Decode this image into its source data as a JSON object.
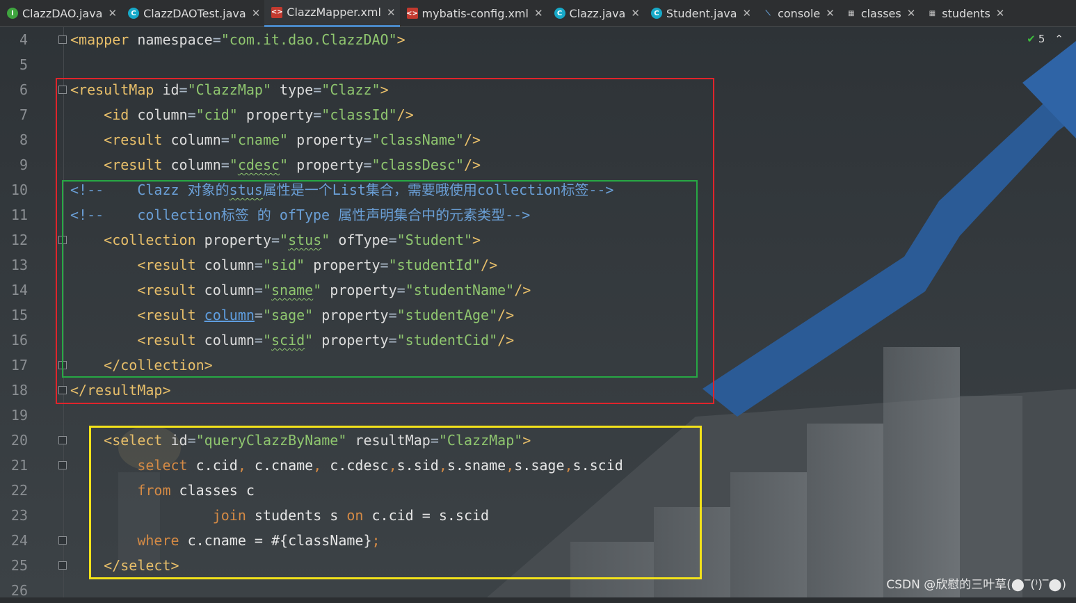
{
  "tabs": [
    {
      "label": "ClazzDAO.java",
      "icon": "interface-icon"
    },
    {
      "label": "ClazzDAOTest.java",
      "icon": "class-icon"
    },
    {
      "label": "ClazzMapper.xml",
      "icon": "xml-icon",
      "active": true
    },
    {
      "label": "mybatis-config.xml",
      "icon": "xml-icon"
    },
    {
      "label": "Clazz.java",
      "icon": "class-icon"
    },
    {
      "label": "Student.java",
      "icon": "class-icon"
    },
    {
      "label": "console",
      "icon": "console-icon"
    },
    {
      "label": "classes",
      "icon": "table-icon"
    },
    {
      "label": "students",
      "icon": "table-icon"
    }
  ],
  "close_glyph": "✕",
  "inspection": {
    "count": "5",
    "up_glyph": "⌃"
  },
  "line_numbers": [
    "4",
    "5",
    "6",
    "7",
    "8",
    "9",
    "10",
    "11",
    "12",
    "13",
    "14",
    "15",
    "16",
    "17",
    "18",
    "19",
    "20",
    "21",
    "22",
    "23",
    "24",
    "25",
    "26"
  ],
  "code": {
    "l4": {
      "t1": "<mapper ",
      "a1": "namespace",
      "v1": "\"com.it.dao.ClazzDAO\"",
      "t2": ">"
    },
    "l6": {
      "t1": "<resultMap ",
      "a1": "id",
      "v1": "\"ClazzMap\"",
      "a2": " type",
      "v2": "\"Clazz\"",
      "t2": ">"
    },
    "l7": {
      "t1": "<id ",
      "a1": "column",
      "v1": "\"cid\"",
      "a2": " property",
      "v2": "\"classId\"",
      "t2": "/>"
    },
    "l8": {
      "t1": "<result ",
      "a1": "column",
      "v1": "\"cname\"",
      "a2": " property",
      "v2": "\"className\"",
      "t2": "/>"
    },
    "l9": {
      "t1": "<result ",
      "a1": "column",
      "v1q1": "\"",
      "v1": "cdesc",
      "v1q2": "\"",
      "a2": " property",
      "v2": "\"classDesc\"",
      "t2": "/>"
    },
    "l10": {
      "c1": "<!--    Clazz 对象的",
      "c2": "stus",
      "c3": "属性是一个List集合，需要哦使用collection标签-->"
    },
    "l11": {
      "c1": "<!--    collection标签 的 ofType 属性声明集合中的元素类型-->"
    },
    "l12": {
      "t1": "<collection ",
      "a1": "property",
      "v1q1": "\"",
      "v1": "stus",
      "v1q2": "\"",
      "a2": " ofType",
      "v2": "\"Student\"",
      "t2": ">"
    },
    "l13": {
      "t1": "<result ",
      "a1": "column",
      "v1": "\"sid\"",
      "a2": " property",
      "v2": "\"studentId\"",
      "t2": "/>"
    },
    "l14": {
      "t1": "<result ",
      "a1": "column",
      "v1q1": "\"",
      "v1": "sname",
      "v1q2": "\"",
      "a2": " property",
      "v2": "\"studentName\"",
      "t2": "/>"
    },
    "l15": {
      "t1": "<result ",
      "a1": "column",
      "v1": "\"sage\"",
      "a2": " property",
      "v2": "\"studentAge\"",
      "t2": "/>"
    },
    "l16": {
      "t1": "<result ",
      "a1": "column",
      "v1q1": "\"",
      "v1": "scid",
      "v1q2": "\"",
      "a2": " property",
      "v2": "\"studentCid\"",
      "t2": "/>"
    },
    "l17": {
      "t1": "</collection>"
    },
    "l18": {
      "t1": "</resultMap>"
    },
    "l20": {
      "t1": "<select ",
      "a1": "id",
      "v1": "\"queryClazzByName\"",
      "a2": " resultMap",
      "v2": "\"ClazzMap\"",
      "t2": ">"
    },
    "l21": {
      "k1": "select",
      "r1": " c.cid",
      "p1": ",",
      "r2": " c.cname",
      "p2": ",",
      "r3": " c.cdesc",
      "p3": ",",
      "r4": "s.sid",
      "p4": ",",
      "r5": "s.sname",
      "p5": ",",
      "r6": "s.sage",
      "p6": ",",
      "r7": "s.scid"
    },
    "l22": {
      "k1": "from",
      "r1": " classes c"
    },
    "l23": {
      "k1": "join",
      "r1": " students s ",
      "k2": "on",
      "r2": " c.cid = s.scid"
    },
    "l24": {
      "k1": "where",
      "r1": " c.cname = #{className}",
      "p1": ";"
    },
    "l25": {
      "t1": "</select>"
    }
  },
  "eq": "=",
  "watermark": "CSDN @欣慰的三叶草(⬤‾(⁾)‾⬤)",
  "colors": {
    "red_box": "#e0242b",
    "green_box": "#27a844",
    "yellow_box": "#f3e21a",
    "active_tab": "#4a88c7"
  }
}
